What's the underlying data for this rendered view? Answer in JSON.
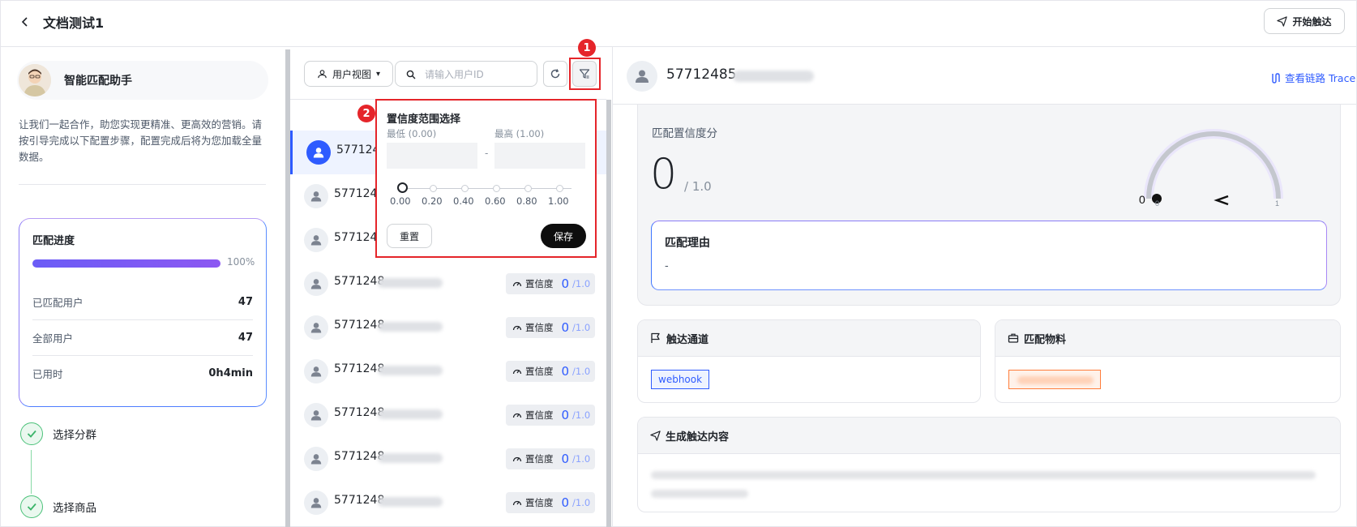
{
  "header": {
    "back_label": "<",
    "title": "文档测试1",
    "start_button": "开始触达"
  },
  "assistant": {
    "name": "智能匹配助手",
    "intro": "让我们一起合作，助您实现更精准、更高效的营销。请按引导完成以下配置步骤，配置完成后将为您加载全量数据。"
  },
  "progress": {
    "title": "匹配进度",
    "percent_label": "100%",
    "percent": 1.0,
    "rows": [
      {
        "label": "已匹配用户",
        "value": "47"
      },
      {
        "label": "全部用户",
        "value": "47"
      },
      {
        "label": "已用时",
        "value": "0h4min"
      }
    ]
  },
  "steps": [
    {
      "label": "选择分群"
    },
    {
      "label": "选择商品"
    }
  ],
  "list_toolbar": {
    "view_select": "用户视图",
    "view_caret": "▾",
    "search_placeholder": "请输入用户ID"
  },
  "users": [
    {
      "id": "577124",
      "active": true
    },
    {
      "id": "577124",
      "active": false
    },
    {
      "id": "577124",
      "active": false
    },
    {
      "id": "5771248",
      "badge_label": "置信度",
      "score": "0",
      "max": "/1.0"
    },
    {
      "id": "5771248",
      "badge_label": "置信度",
      "score": "0",
      "max": "/1.0"
    },
    {
      "id": "5771248",
      "badge_label": "置信度",
      "score": "0",
      "max": "/1.0"
    },
    {
      "id": "5771248",
      "badge_label": "置信度",
      "score": "0",
      "max": "/1.0"
    },
    {
      "id": "5771248",
      "badge_label": "置信度",
      "score": "0",
      "max": "/1.0"
    },
    {
      "id": "5771248",
      "badge_label": "置信度",
      "score": "0",
      "max": "/1.0"
    }
  ],
  "popover": {
    "title": "置信度范围选择",
    "min_label": "最低 (0.00)",
    "max_label": "最高 (1.00)",
    "dash": "-",
    "ticks": [
      "0.00",
      "0.20",
      "0.40",
      "0.60",
      "0.80",
      "1.00"
    ],
    "slider_value": 0.0,
    "reset": "重置",
    "save": "保存"
  },
  "markers": [
    "1",
    "2"
  ],
  "detail": {
    "user_id": "57712485",
    "trace_link": "查看链路 Trace",
    "score_label": "匹配置信度分",
    "score": "0",
    "score_max": "/ 1.0",
    "gauge": {
      "value_label": "0",
      "min": "0",
      "max": "1",
      "value": 0
    },
    "reason_title": "匹配理由",
    "reason_text": "-",
    "channel_title": "触达通道",
    "channel_tag": "webhook",
    "material_title": "匹配物料",
    "generate_title": "生成触达内容"
  },
  "colors": {
    "accent": "#2e5bff",
    "danger": "#e5252a",
    "success": "#4cc27a",
    "progress": "#7b5af5"
  }
}
